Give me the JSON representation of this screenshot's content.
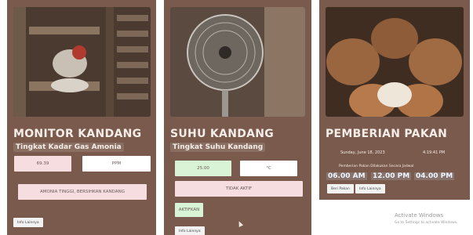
{
  "cards": [
    {
      "title": "MONITOR KANDANG",
      "subtitle": "Tingkat Kadar Gas Amonia",
      "value": "69.39",
      "unit": "PPM",
      "alert": "AMONIA TINGGI, BERSIHKAN KANDANG",
      "button": "Info Lainnya",
      "image_icon": "chicken-coop-image"
    },
    {
      "title": "SUHU KANDANG",
      "subtitle": "Tingkat Suhu Kandang",
      "value": "25.00",
      "unit": "°C",
      "status": "TIDAK AKTIF",
      "toggle": "AKTIFKAN",
      "button": "Info Lainnya",
      "image_icon": "standing-fan-image"
    },
    {
      "title": "PEMBERIAN PAKAN",
      "date": "Sunday, June 18, 2023",
      "time": "4:19:41 PM",
      "info": "Pemberian Pakan Dilakukan Secara Jadwal",
      "schedule": [
        "06.00 AM",
        "12.00 PM",
        "04.00 PM"
      ],
      "button_primary": "Beri Pakan",
      "button_secondary": "Info Lainnya",
      "image_icon": "chickens-eating-image"
    }
  ],
  "watermark": {
    "line1": "Activate Windows",
    "line2": "Go to Settings to activate Windows."
  }
}
